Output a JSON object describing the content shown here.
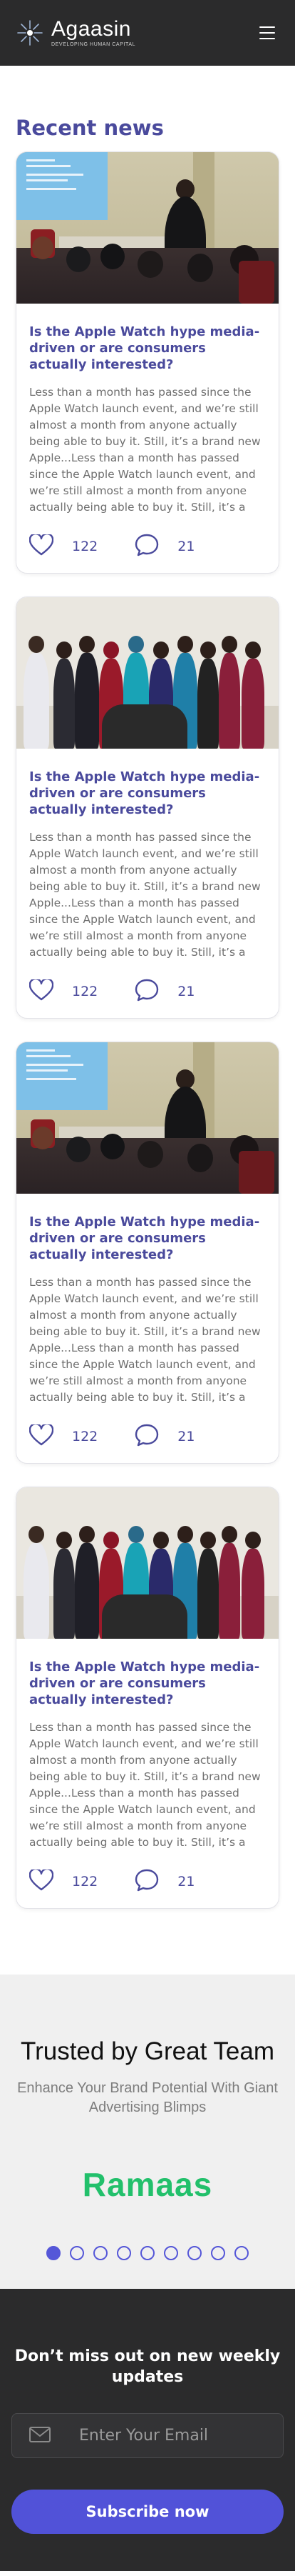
{
  "header": {
    "brand_name": "Agaasin",
    "brand_tagline": "DEVELOPING HUMAN CAPITAL",
    "menu_icon": "hamburger-icon"
  },
  "news": {
    "title": "Recent news",
    "cards": [
      {
        "image": "presentation-photo",
        "title": "Is the Apple Watch hype media-driven or are consumers actually interested?",
        "excerpt": "Less than a month has passed since the Apple Watch launch event, and we’re still almost a month from anyone actually being able to buy it. Still, it’s a brand new Apple...Less than a month has passed since the Apple Watch launch event, and we’re still almost a month from anyone actually being able to buy it. Still, it’s a brand new Apple...",
        "likes": "122",
        "comments": "21"
      },
      {
        "image": "group-photo",
        "title": "Is the Apple Watch hype media-driven or are consumers actually interested?",
        "excerpt": "Less than a month has passed since the Apple Watch launch event, and we’re still almost a month from anyone actually being able to buy it. Still, it’s a brand new Apple...Less than a month has passed since the Apple Watch launch event, and we’re still almost a month from anyone actually being able to buy it. Still, it’s a brand new Apple...",
        "likes": "122",
        "comments": "21"
      },
      {
        "image": "presentation-photo",
        "title": "Is the Apple Watch hype media-driven or are consumers actually interested?",
        "excerpt": "Less than a month has passed since the Apple Watch launch event, and we’re still almost a month from anyone actually being able to buy it. Still, it’s a brand new Apple...Less than a month has passed since the Apple Watch launch event, and we’re still almost a month from anyone actually being able to buy it. Still, it’s a brand new Apple...",
        "likes": "122",
        "comments": "21"
      },
      {
        "image": "group-photo",
        "title": "Is the Apple Watch hype media-driven or are consumers actually interested?",
        "excerpt": "Less than a month has passed since the Apple Watch launch event, and we’re still almost a month from anyone actually being able to buy it. Still, it’s a brand new Apple...Less than a month has passed since the Apple Watch launch event, and we’re still almost a month from anyone actually being able to buy it. Still, it’s a brand new Apple...",
        "likes": "122",
        "comments": "21"
      }
    ]
  },
  "trusted": {
    "title": "Trusted by Great Team",
    "subtitle": "Enhance Your Brand Potential With Giant Advertising Blimps",
    "partner_logo": "Ramaas",
    "carousel_dots": 9,
    "active_dot": 0
  },
  "newsletter": {
    "title": "Don’t miss out on new weekly updates",
    "email_placeholder": "Enter Your Email",
    "subscribe_label": "Subscribe now"
  },
  "colors": {
    "header_bg": "#2b2b2c",
    "accent": "#4a4a9c",
    "button": "#5152d8",
    "partner_green": "#22c06b"
  }
}
